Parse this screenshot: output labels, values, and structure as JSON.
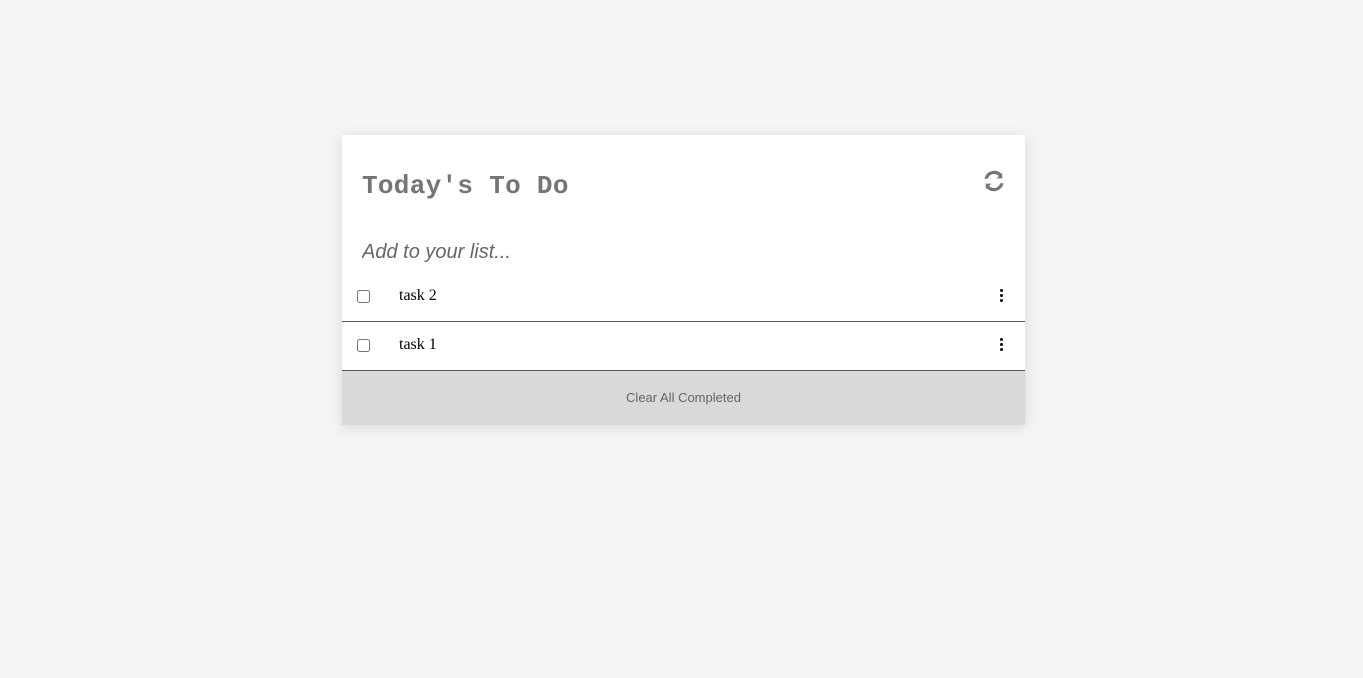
{
  "app": {
    "title": "Today's To Do"
  },
  "toolbar": {
    "refresh_icon": "refresh-icon"
  },
  "add": {
    "placeholder": "Add to your list...",
    "value": ""
  },
  "tasks": [
    {
      "label": "task 2",
      "checked": false,
      "menu_icon": "more-vertical-icon"
    },
    {
      "label": "task 1",
      "checked": false,
      "menu_icon": "more-vertical-icon"
    }
  ],
  "footer": {
    "clear_label": "Clear All Completed"
  },
  "colors": {
    "background": "#f5f5f5",
    "card": "#ffffff",
    "title_text": "#757575",
    "footer_bg": "#d9d9d9",
    "footer_text": "#666666"
  }
}
